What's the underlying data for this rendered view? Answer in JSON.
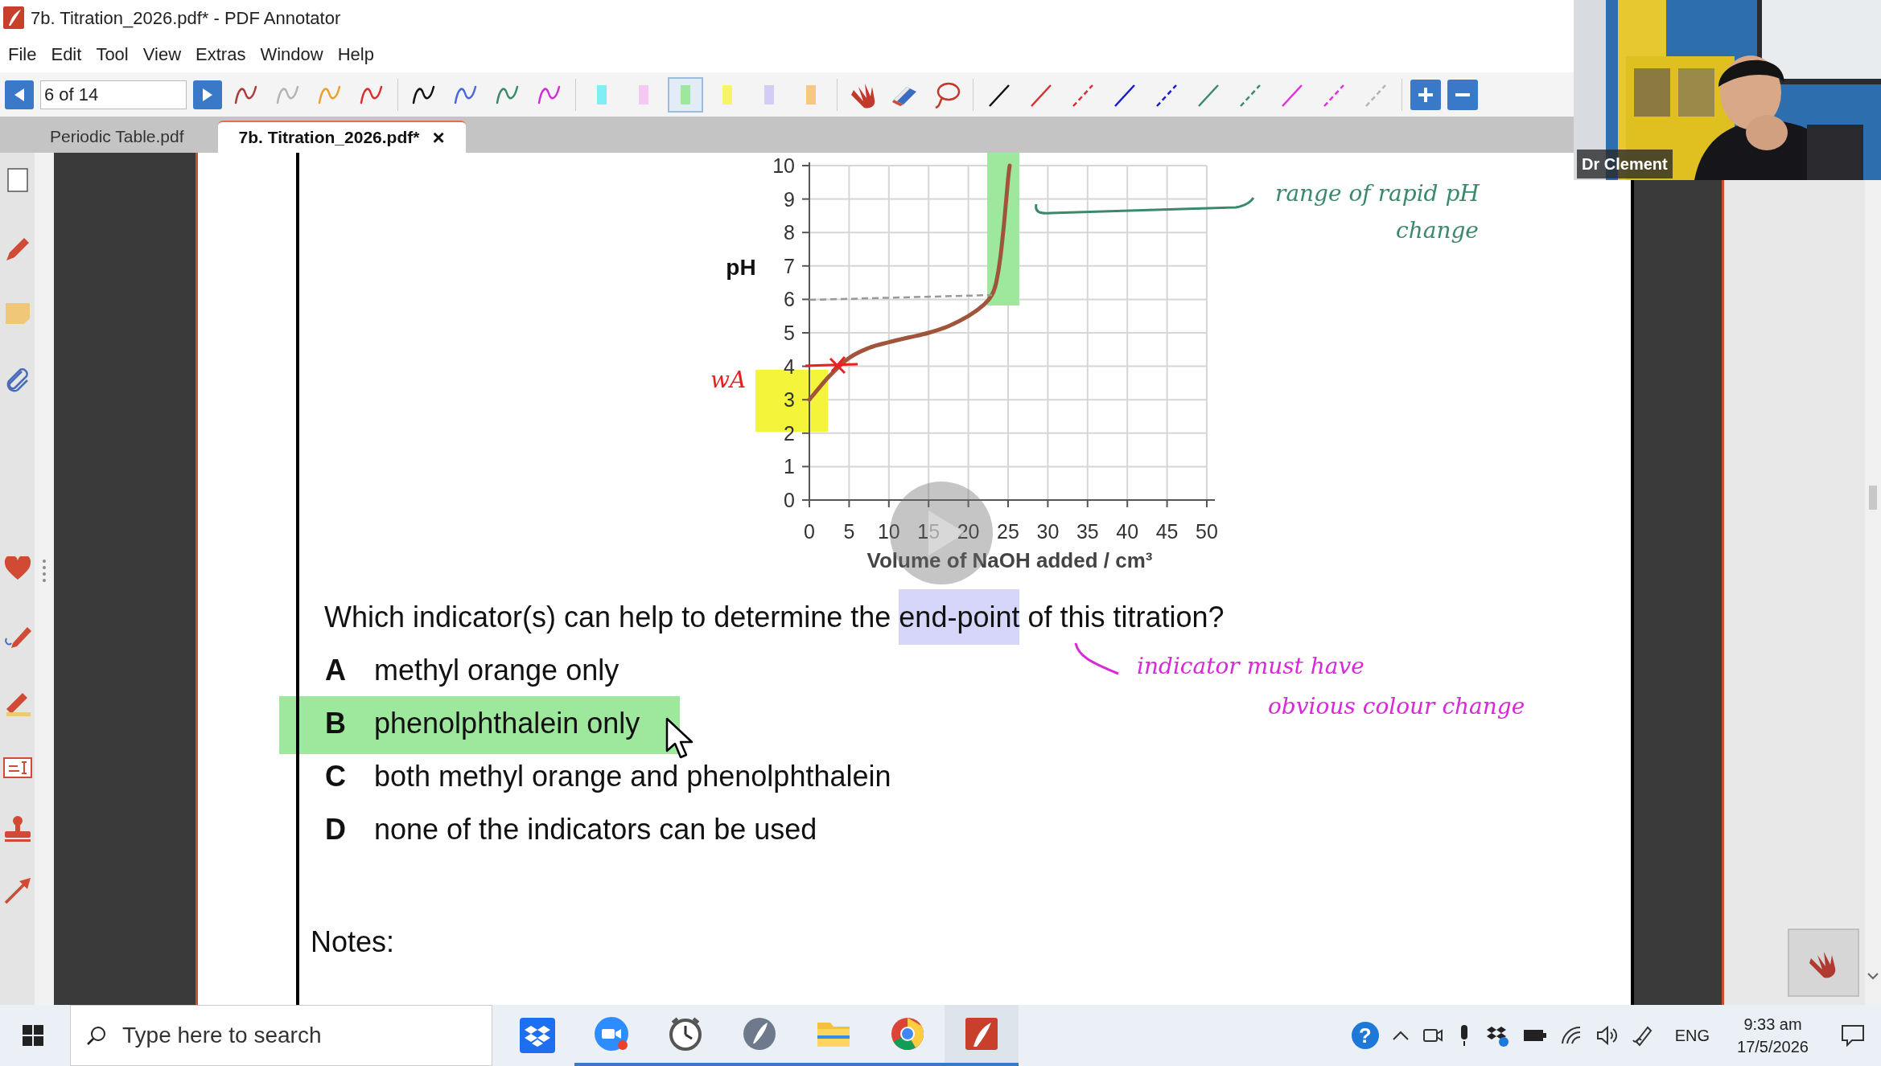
{
  "window": {
    "title": "7b. Titration_2026.pdf* - PDF Annotator"
  },
  "menu": [
    "File",
    "Edit",
    "Tool",
    "View",
    "Extras",
    "Window",
    "Help"
  ],
  "toolbar": {
    "page_field": {
      "value": "6 of 14"
    },
    "tools": [
      {
        "kind": "pen",
        "color": "#a83c3c",
        "selected": false
      },
      {
        "kind": "pen",
        "color": "#b4b4b4",
        "selected": false
      },
      {
        "kind": "pen",
        "color": "#e8a030",
        "selected": false
      },
      {
        "kind": "pen",
        "color": "#d83030",
        "selected": false
      },
      {
        "kind": "pen",
        "color": "#111111",
        "selected": false
      },
      {
        "kind": "pen",
        "color": "#4a68d8",
        "selected": false
      },
      {
        "kind": "pen",
        "color": "#3a8a6a",
        "selected": false
      },
      {
        "kind": "pen",
        "color": "#d030d0",
        "selected": false
      },
      {
        "kind": "highlighter",
        "color": "#80eef4",
        "selected": false
      },
      {
        "kind": "highlighter",
        "color": "#f4c8f0",
        "selected": false
      },
      {
        "kind": "highlighter",
        "color": "#9ee89e",
        "selected": true
      },
      {
        "kind": "highlighter",
        "color": "#f8f46a",
        "selected": false
      },
      {
        "kind": "highlighter",
        "color": "#d4ccf4",
        "selected": false
      },
      {
        "kind": "highlighter",
        "color": "#f6c880",
        "selected": false
      },
      {
        "kind": "hand",
        "selected": false
      },
      {
        "kind": "eraser",
        "selected": false
      },
      {
        "kind": "lasso",
        "selected": false
      },
      {
        "kind": "line",
        "color": "#111111",
        "selected": false
      },
      {
        "kind": "line",
        "color": "#d83030",
        "selected": false
      },
      {
        "kind": "dashed_line",
        "color": "#d83030",
        "selected": false
      },
      {
        "kind": "line",
        "color": "#1a1ad0",
        "selected": false
      },
      {
        "kind": "dashed_line",
        "color": "#1a1ad0",
        "selected": false
      },
      {
        "kind": "line",
        "color": "#3a8a6a",
        "selected": false
      },
      {
        "kind": "dashed_line",
        "color": "#3a8a6a",
        "selected": false
      },
      {
        "kind": "line",
        "color": "#e030e0",
        "selected": false
      },
      {
        "kind": "dashed_line",
        "color": "#e030e0",
        "selected": false
      },
      {
        "kind": "dashed_line",
        "color": "#b4b4b4",
        "selected": false
      }
    ]
  },
  "tabs": [
    {
      "label": "Periodic Table.pdf",
      "selected": false
    },
    {
      "label": "7b. Titration_2026.pdf*",
      "selected": true,
      "close": "×"
    }
  ],
  "document": {
    "chart_data": {
      "type": "line",
      "xlabel": "Volume of NaOH added / cm³",
      "ylabel": "pH",
      "x": [
        0,
        2.5,
        5,
        7.5,
        10,
        12.5,
        15,
        17.5,
        20,
        22,
        23,
        23.5,
        24,
        24.5,
        25,
        25.2
      ],
      "grid": true,
      "series": [
        {
          "color": "#a0553a",
          "values": [
            3,
            3.7,
            4.25,
            4.55,
            4.72,
            4.86,
            5.0,
            5.2,
            5.5,
            5.85,
            6.15,
            6.5,
            7.2,
            8.3,
            9.6,
            10
          ]
        }
      ],
      "xlim": [
        0,
        50
      ],
      "ylim": [
        0,
        10
      ],
      "xticks": [
        0,
        5,
        10,
        15,
        20,
        25,
        30,
        35,
        40,
        45,
        50
      ],
      "yticks": [
        0,
        1,
        2,
        3,
        4,
        5,
        6,
        7,
        8,
        9,
        10
      ]
    },
    "question": [
      {
        "text": "Which indicator(s) can help to determine the ",
        "highlighted": false
      },
      {
        "text": "end-point",
        "highlighted": true
      },
      {
        "text": " of this titration?",
        "highlighted": false
      }
    ],
    "options": [
      {
        "letter": "A",
        "text": "methyl orange only",
        "highlighted": false
      },
      {
        "letter": "B",
        "text": "phenolphthalein only",
        "highlighted": true
      },
      {
        "letter": "C",
        "text": "both methyl orange and phenolphthalein",
        "highlighted": false
      },
      {
        "letter": "D",
        "text": "none of the indicators can be used",
        "highlighted": false
      }
    ],
    "notes_label": "Notes:",
    "handwritten_notes": [
      {
        "text": "range of rapid pH",
        "color": "#3a8a6a"
      },
      {
        "text": "change",
        "color": "#3a8a6a"
      },
      {
        "text": "wA",
        "color": "#e82020"
      },
      {
        "text": "indicator must have",
        "color": "#d828d8"
      },
      {
        "text": "obvious colour change",
        "color": "#d828d8"
      }
    ]
  },
  "video_call": {
    "kind": "picture",
    "name_label": "Dr Clement"
  },
  "taskbar": {
    "search": {
      "placeholder": "Type here to search"
    },
    "help": "?",
    "language": "ENG",
    "time": "9:33 am",
    "date": "17/5/2026"
  }
}
